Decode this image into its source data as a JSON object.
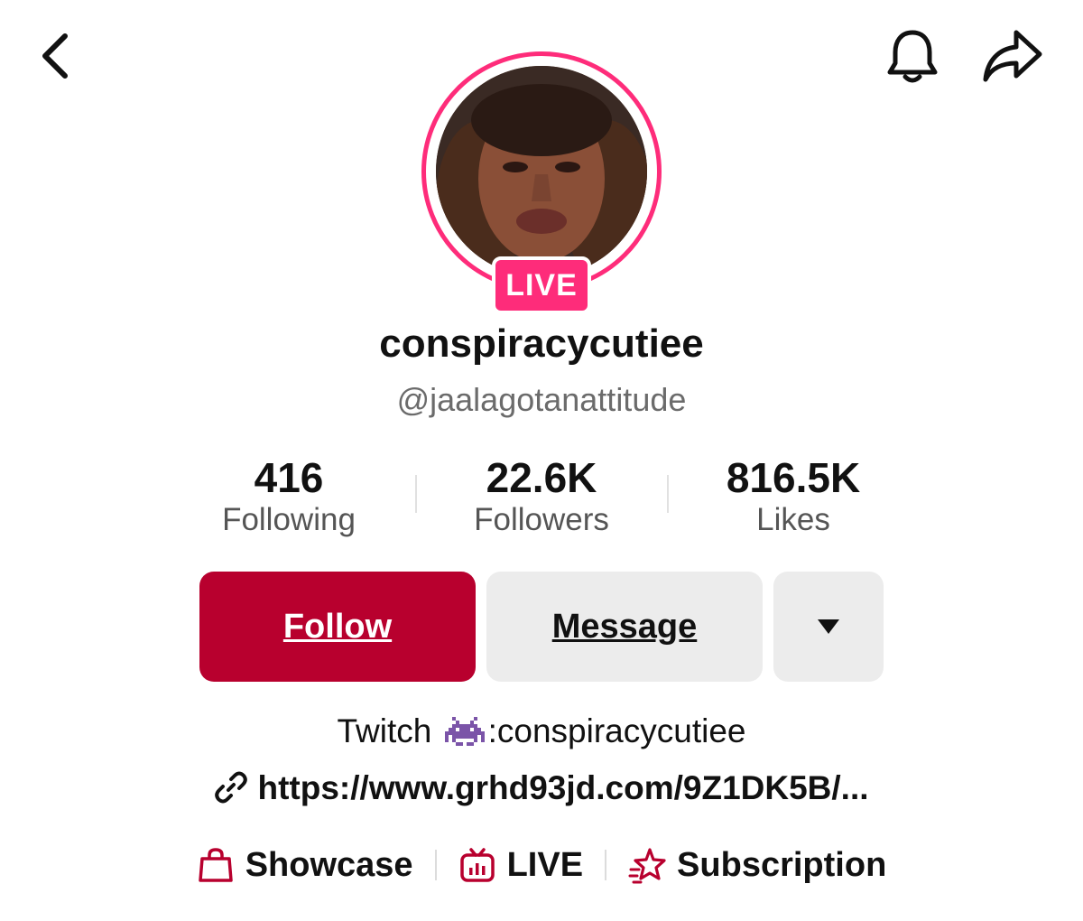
{
  "header": {
    "back_icon": "chevron-left-icon",
    "bell_icon": "bell-icon",
    "share_icon": "share-arrow-icon"
  },
  "profile": {
    "live_badge": "LIVE",
    "display_name": "conspiracycutiee",
    "username": "@jaalagotanattitude",
    "ring_color": "#fe2c7a"
  },
  "stats": [
    {
      "value": "416",
      "label": "Following"
    },
    {
      "value": "22.6K",
      "label": "Followers"
    },
    {
      "value": "816.5K",
      "label": "Likes"
    }
  ],
  "actions": {
    "follow_label": "Follow",
    "message_label": "Message",
    "more_icon": "caret-down-icon",
    "follow_color": "#b8002e"
  },
  "bio": {
    "prefix": "Twitch",
    "emoji": "space-invader-emoji",
    "handle": ":conspiracycutiee",
    "link": "https://www.grhd93jd.com/9Z1DK5B/..."
  },
  "tabs": [
    {
      "label": "Showcase",
      "icon": "shopping-bag-icon"
    },
    {
      "label": "LIVE",
      "icon": "tv-live-icon"
    },
    {
      "label": "Subscription",
      "icon": "star-subscription-icon"
    }
  ],
  "icon_accent": "#b8002e"
}
